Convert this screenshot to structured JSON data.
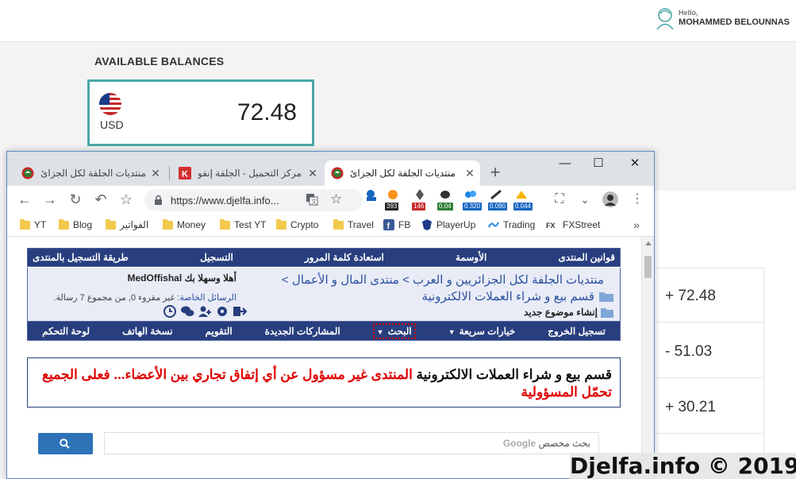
{
  "wallet": {
    "hello": "Hello,",
    "user_name": "MOHAMMED BELOUNNAS",
    "balances_title": "AVAILABLE BALANCES",
    "currency": "USD",
    "balance": "72.48",
    "transactions": [
      "+ 72.48",
      "- 51.03",
      "+ 30.21"
    ]
  },
  "browser": {
    "tabs": [
      {
        "title": "منتديات الجلفة لكل الجزائ",
        "favicon": "djelfa-icon",
        "active": false
      },
      {
        "title": "مركز التحميل - الجلفة إنفو",
        "favicon": "k-icon",
        "active": false
      },
      {
        "title": "منتديات الجلفة لكل الجزائ",
        "favicon": "djelfa-icon",
        "active": true
      }
    ],
    "new_tab": "+",
    "window_controls": {
      "minimize": "—",
      "maximize": "☐",
      "close": "✕"
    },
    "url": "https://www.djelfa.info...",
    "extension_badges": [
      "393",
      "146",
      "0.04",
      "0.320",
      "0.090",
      "0.044"
    ],
    "extension_colors": [
      "#222222",
      "#c62828",
      "#2e7d32",
      "#1565c0",
      "#1565c0",
      "#1565c0"
    ],
    "bookmarks": [
      {
        "label": "YT",
        "icon": "folder-icon"
      },
      {
        "label": "Blog",
        "icon": "folder-icon"
      },
      {
        "label": "الفواتير",
        "icon": "folder-icon"
      },
      {
        "label": "Money",
        "icon": "folder-icon"
      },
      {
        "label": "Test YT",
        "icon": "folder-icon"
      },
      {
        "label": "Crypto",
        "icon": "folder-icon"
      },
      {
        "label": "Travel",
        "icon": "folder-icon"
      },
      {
        "label": "FB",
        "icon": "facebook-icon"
      },
      {
        "label": "PlayerUp",
        "icon": "playerup-icon"
      },
      {
        "label": "Trading",
        "icon": "trading-icon"
      },
      {
        "label": "FXStreet",
        "icon": "fxstreet-icon"
      }
    ],
    "bookmarks_more": "»"
  },
  "forum": {
    "top_nav": [
      "طريقة التسجيل بالمنتدى",
      "التسجيل",
      "استعادة كلمة المرور",
      "الأوسمة",
      "قوانين المنتدى"
    ],
    "breadcrumb_line1": "منتديات الجلفة لكل الجزائريين و العرب > منتدى المال و الأعمال >",
    "breadcrumb_line2": "قسم بيع و شراء العملات الالكترونية",
    "new_topic": "إنشاء موضوع جديد",
    "welcome_prefix": "أهلا وسهلا بك",
    "welcome_user": "MedOffishal",
    "pm_label": "الرسائل الخاصة",
    "pm_text": ": غير مقروء 0, من مجموع 7 رسالة.",
    "bottom_nav": [
      "لوحة التحكم",
      "نسخة الهاتف",
      "التقويم",
      "المشاركات الجديدة",
      "البحث",
      "خيارات سريعة",
      "تسجيل الخروج"
    ],
    "notice_part1": "قسم بيع و شراء العملات الالكترونية",
    "notice_part2": "المنتدى غير مسؤول عن أي إتفاق تجاري بين الأعضاء... فعلى الجميع تحمّل المسؤولية",
    "search_brand": "Google",
    "search_placeholder": "بحث مخصص"
  },
  "watermark": "Djelfa.info © 2019"
}
